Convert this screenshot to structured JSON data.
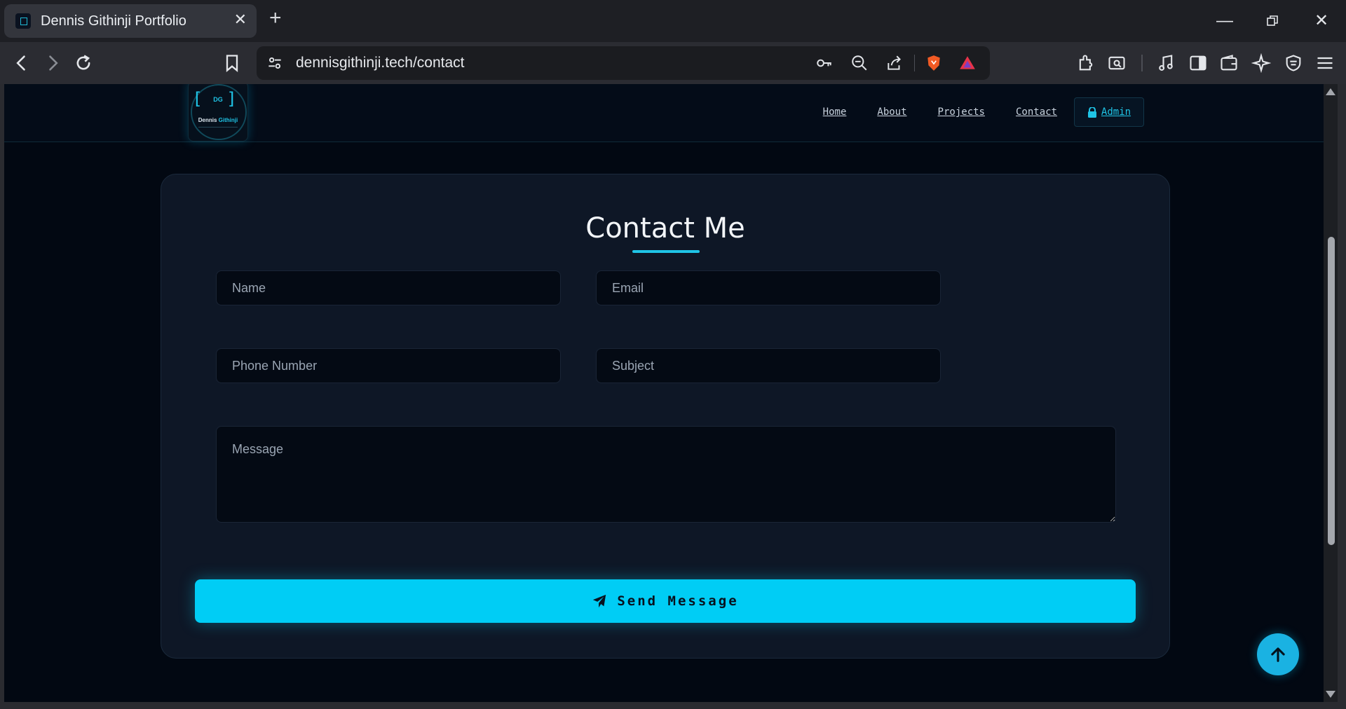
{
  "browser": {
    "tab_title": "Dennis Githinji Portfolio",
    "url": "dennisgithinji.tech/contact"
  },
  "site": {
    "logo": {
      "initials": "DG",
      "name_first": "Dennis",
      "name_last": "Githinji"
    },
    "nav": {
      "home": "Home",
      "about": "About",
      "projects": "Projects",
      "contact": "Contact",
      "admin": "Admin"
    }
  },
  "contact_form": {
    "title": "Contact Me",
    "name_placeholder": "Name",
    "email_placeholder": "Email",
    "phone_placeholder": "Phone Number",
    "subject_placeholder": "Subject",
    "message_placeholder": "Message",
    "send_label": "Send Message"
  },
  "colors": {
    "accent": "#00cdf5",
    "page_bg": "#020812",
    "card_bg": "#0e1726"
  },
  "icons": {
    "send": "paper-plane-icon",
    "admin": "lock-icon",
    "scroll_top": "arrow-up-icon"
  }
}
